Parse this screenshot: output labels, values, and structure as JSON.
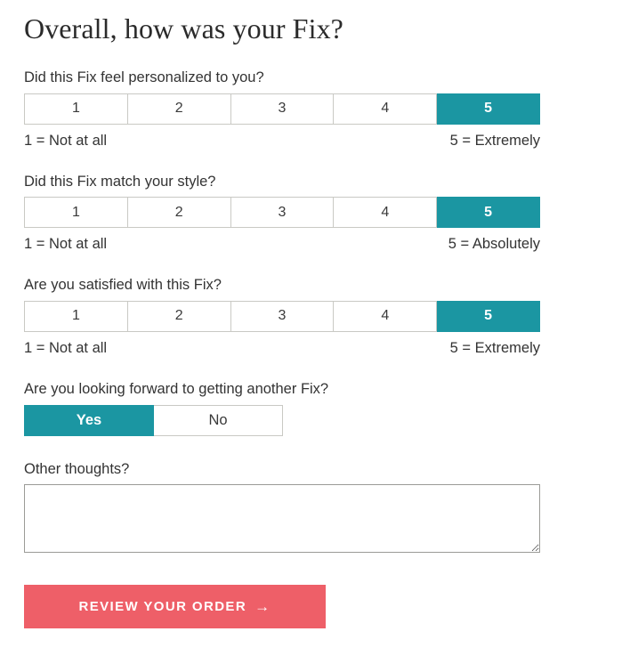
{
  "page": {
    "title": "Overall, how was your Fix?"
  },
  "colors": {
    "accent_teal": "#1b96a2",
    "submit_coral": "#ee5f68",
    "box_border": "#c9c9c4",
    "textarea_border": "#9b9b97",
    "text": "#333333",
    "title_text": "#2b2b2b"
  },
  "questions": [
    {
      "label": "Did this Fix feel personalized to you?",
      "type": "scale",
      "options": [
        "1",
        "2",
        "3",
        "4",
        "5"
      ],
      "selected": "5",
      "anchor_low": "1 = Not at all",
      "anchor_high": "5 = Extremely"
    },
    {
      "label": "Did this Fix match your style?",
      "type": "scale",
      "options": [
        "1",
        "2",
        "3",
        "4",
        "5"
      ],
      "selected": "5",
      "anchor_low": "1 = Not at all",
      "anchor_high": "5 = Absolutely"
    },
    {
      "label": "Are you satisfied with this Fix?",
      "type": "scale",
      "options": [
        "1",
        "2",
        "3",
        "4",
        "5"
      ],
      "selected": "5",
      "anchor_low": "1 = Not at all",
      "anchor_high": "5 = Extremely"
    }
  ],
  "binary_question": {
    "label": "Are you looking forward to getting another Fix?",
    "options": [
      "Yes",
      "No"
    ],
    "selected": "Yes"
  },
  "thoughts": {
    "label": "Other thoughts?",
    "value": "",
    "placeholder": ""
  },
  "submit": {
    "label": "REVIEW YOUR ORDER",
    "arrow_icon": "arrow-right-icon",
    "arrow_glyph": "→"
  }
}
